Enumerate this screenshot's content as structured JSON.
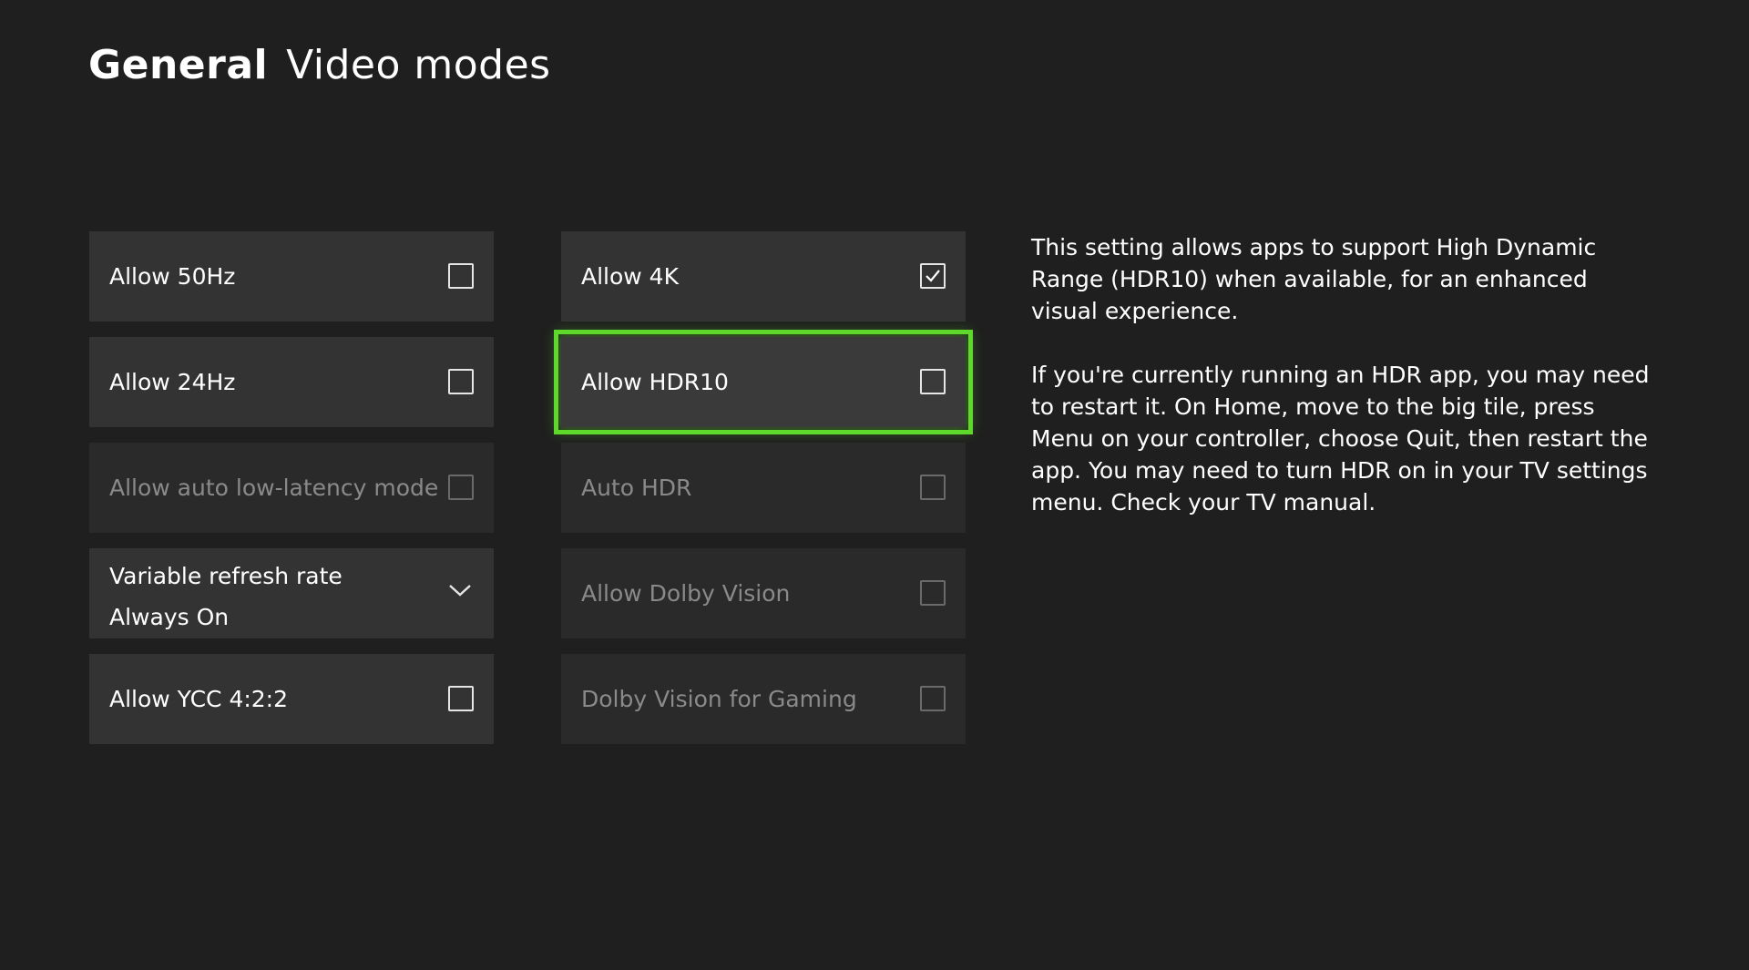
{
  "header": {
    "section": "General",
    "page": "Video modes"
  },
  "left_column": [
    {
      "label": "Allow 50Hz",
      "type": "checkbox",
      "checked": false,
      "disabled": false
    },
    {
      "label": "Allow 24Hz",
      "type": "checkbox",
      "checked": false,
      "disabled": false
    },
    {
      "label": "Allow auto low-latency mode",
      "type": "checkbox",
      "checked": false,
      "disabled": true
    },
    {
      "label": "Variable refresh rate",
      "value": "Always On",
      "type": "dropdown",
      "disabled": false
    },
    {
      "label": "Allow YCC 4:2:2",
      "type": "checkbox",
      "checked": false,
      "disabled": false
    }
  ],
  "mid_column": [
    {
      "label": "Allow 4K",
      "type": "checkbox",
      "checked": true,
      "disabled": false
    },
    {
      "label": "Allow HDR10",
      "type": "checkbox",
      "checked": false,
      "disabled": false,
      "focused": true
    },
    {
      "label": "Auto HDR",
      "type": "checkbox",
      "checked": false,
      "disabled": true
    },
    {
      "label": "Allow Dolby Vision",
      "type": "checkbox",
      "checked": false,
      "disabled": true
    },
    {
      "label": "Dolby Vision for Gaming",
      "type": "checkbox",
      "checked": false,
      "disabled": true
    }
  ],
  "description": {
    "p1": "This setting allows apps to support High Dynamic Range (HDR10) when available, for an enhanced visual experience.",
    "p2": "If you're currently running an HDR app, you may need to restart it. On Home, move to the big tile, press Menu on your controller, choose Quit, then restart the app. You may need to turn HDR on in your TV settings menu. Check your TV manual."
  },
  "colors": {
    "background": "#1f1f1f",
    "tile": "#333333",
    "tile_disabled": "#2a2a2a",
    "focus": "#5fd82c",
    "text": "#ffffff",
    "text_disabled": "#8a8a8a"
  },
  "icons": {
    "checkbox": "checkbox-icon",
    "check": "checkmark-icon",
    "dropdown": "chevron-down-icon"
  }
}
